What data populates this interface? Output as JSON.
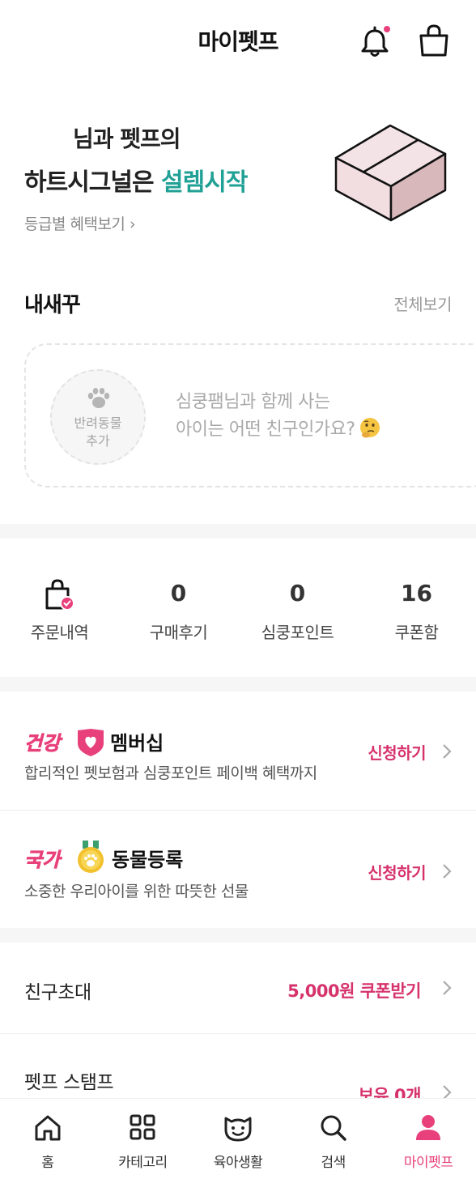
{
  "header": {
    "title": "마이펫프"
  },
  "hero": {
    "line1": "님과 펫프의",
    "line2_prefix": "하트시그널은 ",
    "line2_accent": "설렘시작",
    "grade_link": "등급별 혜택보기 ›"
  },
  "pets": {
    "section_title": "내새꾸",
    "see_all": "전체보기",
    "add_label": "반려동물\n추가",
    "prompt_line1": "심쿵팸님과 함께 사는",
    "prompt_line2": "아이는 어떤 친구인가요?"
  },
  "stats": [
    {
      "value": "",
      "label": "주문내역"
    },
    {
      "value": "0",
      "label": "구매후기"
    },
    {
      "value": "0",
      "label": "심쿵포인트"
    },
    {
      "value": "16",
      "label": "쿠폰함"
    }
  ],
  "membership": {
    "badge": "건강",
    "title": "멤버십",
    "description": "합리적인 펫보험과 심쿵포인트 페이백 혜택까지",
    "cta": "신청하기"
  },
  "registration": {
    "badge": "국가",
    "title": "동물등록",
    "description": "소중한 우리아이를 위한 따뜻한 선물",
    "cta": "신청하기"
  },
  "rows": [
    {
      "label": "친구초대",
      "value": "5,000원 쿠폰받기"
    },
    {
      "label": "펫프 스탬프",
      "value": "보유 0개"
    }
  ],
  "tabs": [
    {
      "label": "홈",
      "icon": "home-icon"
    },
    {
      "label": "카테고리",
      "icon": "grid-icon"
    },
    {
      "label": "육아생활",
      "icon": "pet-face-icon"
    },
    {
      "label": "검색",
      "icon": "search-icon"
    },
    {
      "label": "마이펫프",
      "icon": "person-icon"
    }
  ],
  "colors": {
    "accent_teal": "#21a195",
    "accent_pink": "#d6336c",
    "active_tab": "#e8407a"
  }
}
